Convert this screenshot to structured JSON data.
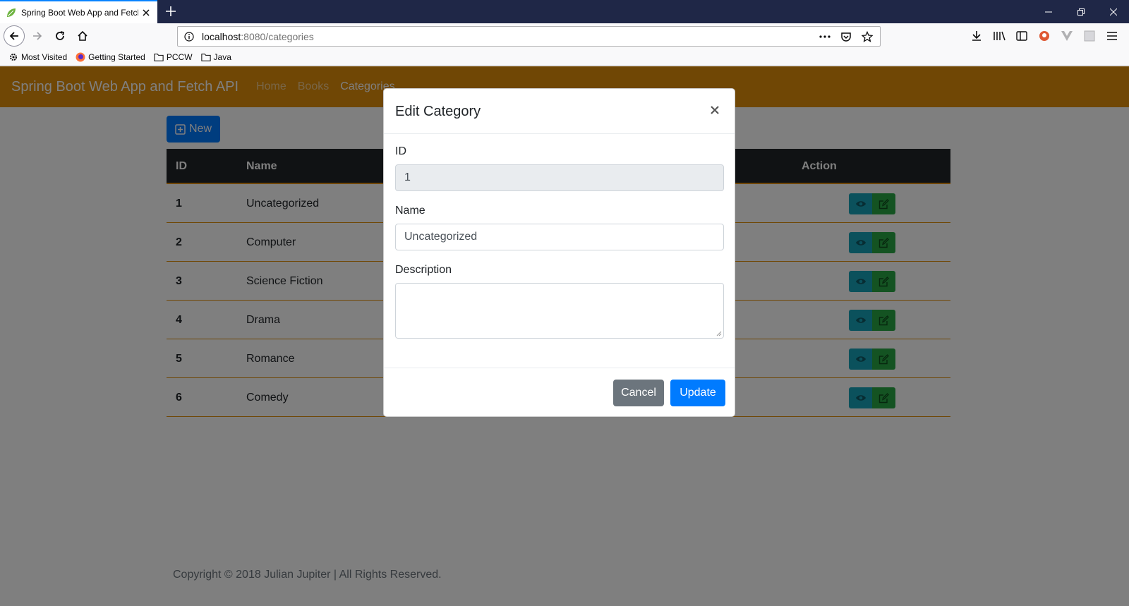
{
  "browser": {
    "tab_title": "Spring Boot Web App and Fetch API",
    "url_host": "localhost",
    "url_rest": ":8080/categories",
    "bookmarks": [
      "Most Visited",
      "Getting Started",
      "PCCW",
      "Java"
    ]
  },
  "navbar": {
    "brand": "Spring Boot Web App and Fetch API",
    "links": [
      "Home",
      "Books",
      "Categories"
    ],
    "active_link": "Categories",
    "color": "#e08e0b"
  },
  "toolbar": {
    "new_label": "New"
  },
  "table": {
    "headers": {
      "id": "ID",
      "name": "Name",
      "action": "Action"
    },
    "rows": [
      {
        "id": "1",
        "name": "Uncategorized"
      },
      {
        "id": "2",
        "name": "Computer"
      },
      {
        "id": "3",
        "name": "Science Fiction"
      },
      {
        "id": "4",
        "name": "Drama"
      },
      {
        "id": "5",
        "name": "Romance"
      },
      {
        "id": "6",
        "name": "Comedy"
      }
    ]
  },
  "footer": {
    "text": "Copyright © 2018 Julian Jupiter | All Rights Reserved."
  },
  "modal": {
    "title": "Edit Category",
    "id_label": "ID",
    "id_value": "1",
    "name_label": "Name",
    "name_value": "Uncategorized",
    "description_label": "Description",
    "description_value": "",
    "cancel_label": "Cancel",
    "update_label": "Update"
  }
}
